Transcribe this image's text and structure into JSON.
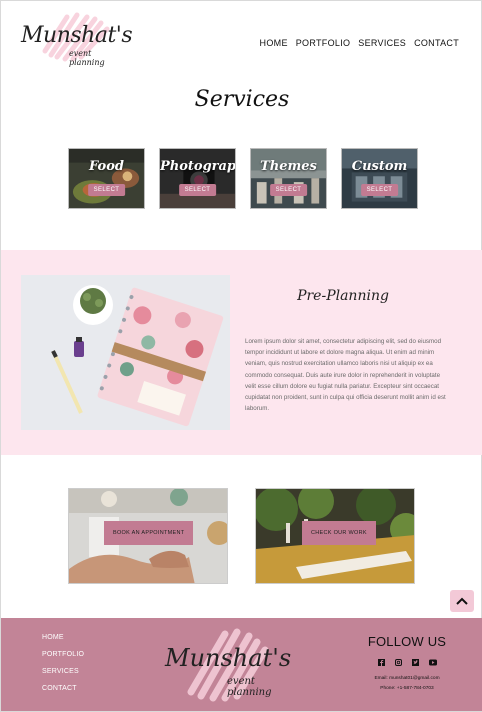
{
  "logo": {
    "script": "Munshat's",
    "sub": "event planning"
  },
  "nav": {
    "items": [
      "HOME",
      "PORTFOLIO",
      "SERVICES",
      "CONTACT"
    ]
  },
  "services": {
    "title": "Services",
    "cards": [
      {
        "label": "Food",
        "button": "SELECT"
      },
      {
        "label": "Photography",
        "button": "SELECT"
      },
      {
        "label": "Themes",
        "button": "SELECT"
      },
      {
        "label": "Custom",
        "button": "SELECT"
      }
    ]
  },
  "preplanning": {
    "title": "Pre-Planning",
    "body": "Lorem ipsum dolor sit amet, consectetur adipiscing elit, sed do eiusmod tempor incididunt ut labore et dolore magna aliqua. Ut enim ad minim veniam, quis nostrud exercitation ullamco laboris nisi ut aliquip ex ea commodo consequat. Duis aute irure dolor in reprehenderit in voluptate velit esse cillum dolore eu fugiat nulla pariatur. Excepteur sint occaecat cupidatat non proident, sunt in culpa qui officia deserunt mollit anim id est laborum."
  },
  "cta": {
    "appointment": "BOOK AN APPOINTMENT",
    "work": "CHECK OUR WORK"
  },
  "footer": {
    "nav": [
      "HOME",
      "PORTFOLIO",
      "SERVICES",
      "CONTACT"
    ],
    "follow": "FOLLOW US",
    "icons": [
      "facebook-icon",
      "instagram-icon",
      "twitter-icon",
      "youtube-icon"
    ],
    "email": "Email: munshat01@gmail.com",
    "phone": "Phone: +1-587-784-0703"
  },
  "colors": {
    "accent": "#c27b92",
    "band": "#fde6ee",
    "footer": "#c28497"
  }
}
